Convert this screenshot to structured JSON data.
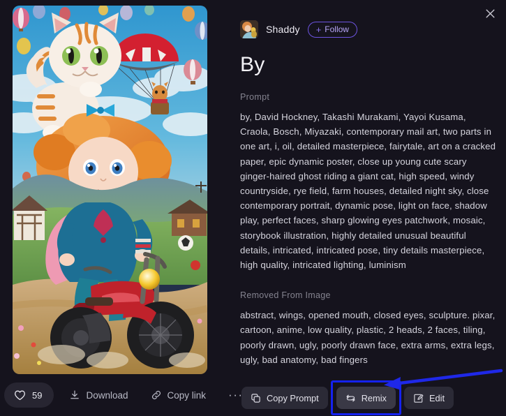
{
  "window": {
    "background_color": "#15131d",
    "close_icon": "close-icon"
  },
  "artwork": {
    "alt": "Ginger-haired girl riding a red motorcycle with a large orange-and-white cat on her head, hot air balloons and a parachuting cat in a blue cloudy sky, green countryside with farm houses",
    "sky_color": "#3fa8d8",
    "hair_color": "#e2802c",
    "bike_color": "#c0222b"
  },
  "image_actions": {
    "like": {
      "icon": "heart-icon",
      "count": "59"
    },
    "download": {
      "icon": "download-icon",
      "label": "Download"
    },
    "copy_link": {
      "icon": "link-icon",
      "label": "Copy link"
    },
    "more": {
      "icon": "more-horizontal-icon",
      "label": "···"
    }
  },
  "author": {
    "avatar_icon": "user-avatar",
    "name": "Shaddy",
    "follow_label": "Follow",
    "follow_plus": "+",
    "accent_color": "#6d54e0"
  },
  "title": "By",
  "prompt": {
    "label": "Prompt",
    "text": "by, David Hockney, Takashi Murakami, Yayoi Kusama, Craola, Bosch, Miyazaki, contemporary mail art, two parts in one art, i, oil, detailed masterpiece, fairytale, art on a cracked paper, epic dynamic poster, close up young cute scary ginger-haired ghost riding a giant cat, high speed, windy countryside, rye field, farm houses, detailed night sky, close contemporary portrait, dynamic pose, light on face, shadow play, perfect faces, sharp glowing eyes patchwork, mosaic, storybook illustration, highly detailed unusual beautiful details, intricated, intricated pose, tiny details masterpiece, high quality, intricated lighting, luminism"
  },
  "removed": {
    "label": "Removed From Image",
    "text": "abstract, wings, opened mouth, closed eyes, sculpture. pixar, cartoon, anime, low quality, plastic, 2 heads, 2 faces, tiling, poorly drawn, ugly, poorly drawn face, extra arms, extra legs, ugly, bad anatomy, bad fingers"
  },
  "detail_actions": {
    "copy_prompt": {
      "icon": "copy-icon",
      "label": "Copy Prompt"
    },
    "remix": {
      "icon": "remix-icon",
      "label": "Remix"
    },
    "edit": {
      "icon": "edit-icon",
      "label": "Edit"
    }
  },
  "annotation": {
    "highlight_color": "#1522f0",
    "arrow_color": "#1f28e8",
    "target": "Remix"
  }
}
